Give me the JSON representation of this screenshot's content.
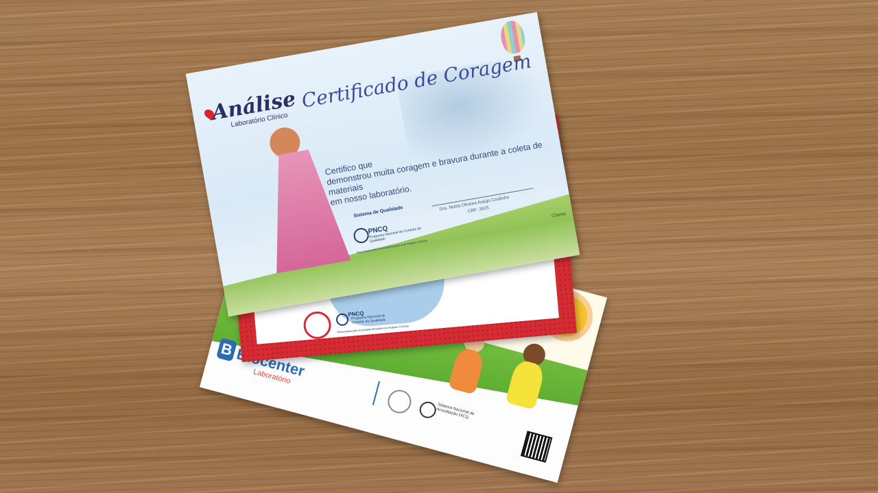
{
  "scene": {
    "background": "wooden-table",
    "colors": {
      "wood": "#a07650",
      "red_card": "#d62b34",
      "navy_text": "#2a2f66",
      "grass": "#7cc447"
    }
  },
  "certificate": {
    "brand": "Análise",
    "brand_sub": "Laboratório Clínico",
    "title": "Certificado de Coragem",
    "line1": "Certifico que",
    "line2": "demonstrou muita coragem e bravura durante a coleta de materiais",
    "line3": "em nosso laboratório.",
    "quality_label": "Sistema de Qualidade",
    "pncq": "PNCQ",
    "pncq_sub": "Programa Nacional de Controle de Qualidade",
    "pncq_foot": "Patrocinado pela Sociedade Brasileira de Análises Clínicas",
    "signature_name": "Dra. Nohla Oliveira Araújo Coutinho",
    "signature_crf": "CRF: 2625",
    "corner_mark": "Clarea"
  },
  "red_card": {
    "pncq": "PNCQ",
    "pncq_sub": "Programa Nacional de Controle de Qualidade",
    "pncq_foot": "Patrocinado pela Sociedade Brasileira de Análises Clínicas"
  },
  "bio_card": {
    "logo": "Biocenter",
    "logo_sub": "Laboratório",
    "accreditation": "Sistema Nacional de Acreditação DICQ"
  }
}
